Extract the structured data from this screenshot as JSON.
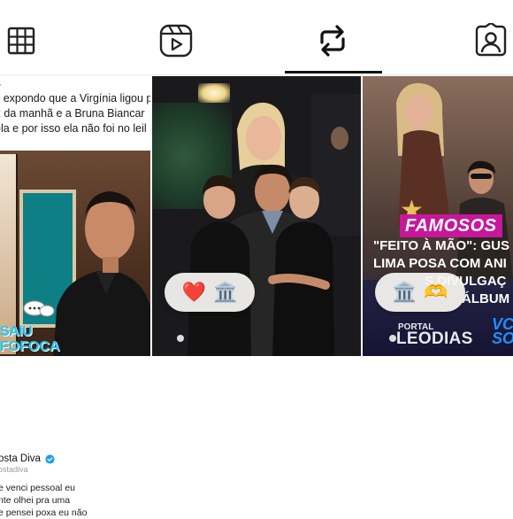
{
  "tabs": [
    {
      "name": "grid-icon",
      "label": "Posts grid"
    },
    {
      "name": "reels-icon",
      "label": "Reels"
    },
    {
      "name": "reposts-icon",
      "label": "Reposts"
    },
    {
      "name": "tagged-icon",
      "label": "Tagged"
    }
  ],
  "active_tab": 2,
  "grid": {
    "tile1": {
      "tweet_lines": [
        "s",
        "s expondo que a Virgínia ligou p",
        "2 da manhã e a Bruna Biancar",
        "ela e por isso ela não foi no leil"
      ],
      "logo_line1": "SAIU",
      "logo_line2": "FOFOCA"
    },
    "tile2": {
      "reactions": [
        "❤️",
        "🏛️"
      ]
    },
    "tile3": {
      "banner": "FAMOSOS",
      "headline_lines": [
        "\"FEITO À MÃO\": GUS",
        "LIMA POSA COM ANI",
        "S DIVULGAÇ",
        "ÁLBUM"
      ],
      "brand_small": "PORTAL",
      "brand": "LEODIAS",
      "side_text": "VC SO",
      "reactions": [
        "🏛️",
        "🫶"
      ]
    }
  },
  "bottom_post": {
    "name": "osta Diva",
    "handle": "ostadiva",
    "lines": [
      "e venci pessoal eu",
      "nte olhei pra uma",
      "e pensei poxa eu não"
    ]
  },
  "colors": {
    "indicator": "#111111",
    "banner": "#c7179b",
    "verified": "#1d9bf0",
    "logo": "#1ec6f0"
  }
}
